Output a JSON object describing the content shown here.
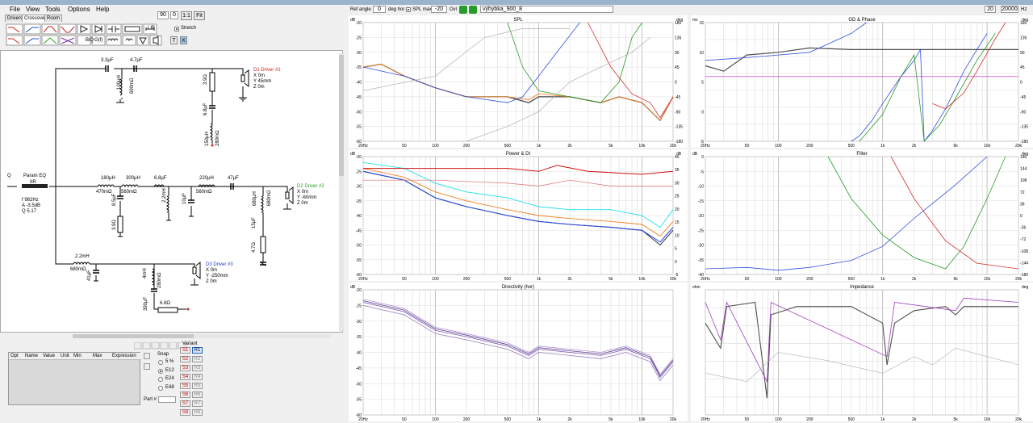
{
  "menu": [
    "File",
    "View",
    "Tools",
    "Options",
    "Help"
  ],
  "left_top": {
    "box1": "90",
    "box2": "0",
    "btn1": "1:1",
    "btn2": "Fit"
  },
  "tabs": [
    "Drivers",
    "Crossover",
    "Room"
  ],
  "toolbar": {
    "biq": "BiQ",
    "gs": "G(f)",
    "lib": "LIB",
    "t": "T",
    "x": "X",
    "stretch": "Stretch"
  },
  "schematic": {
    "param_eq": "Param EQ",
    "iir": "IIR",
    "q_label": "Q",
    "eq_f": "f  982Hz",
    "eq_a": "A  -3.5dB",
    "eq_q": "Q  5.17",
    "driver1": {
      "name": "D1 Driver #1",
      "x": "X  0m",
      "y": "Y  45mm",
      "z": "Z  0m"
    },
    "driver2": {
      "name": "D2 Driver #2",
      "x": "X  0m",
      "y": "Y  -60mm",
      "z": "Z  0m"
    },
    "driver3": {
      "name": "D3 Driver #3",
      "x": "X  0m",
      "y": "Y  -250mm",
      "z": "Z  0m"
    },
    "c1": "3.3µF",
    "c2": "4.7µF",
    "l1": "100µH",
    "r1": "690mΩ",
    "r2": "3.9Ω",
    "c3": "6.8µF",
    "l2": "150µH",
    "r3": "280mΩ",
    "l3": "180µH",
    "r4": "470mΩ",
    "l4": "300µH",
    "r5": "560mΩ",
    "c4": "6.8µF",
    "l5": "2.2mH",
    "c5": "10µF",
    "c6": "8.5µF",
    "r6": "3.9Ω",
    "l6": "220µH",
    "r7": "560mΩ",
    "c7": "47µF",
    "l7": "680µH",
    "r8": "680mΩ",
    "c8": "15µF",
    "r9": "4.7Ω",
    "l8": "2.2mH",
    "r10": "680mΩ",
    "c9": "41µF",
    "l9": "4mH",
    "r11": "280mΩ",
    "c10": "390µF",
    "r12": "6.8Ω"
  },
  "opt_table": {
    "headers": [
      "Opt",
      "Name",
      "Value",
      "Unit",
      "Min",
      "Max",
      "Expression"
    ]
  },
  "snap": {
    "label": "Snap",
    "options": [
      "5 %",
      "E12",
      "E24",
      "E48"
    ],
    "selected": 1,
    "part": "Part #"
  },
  "variant": {
    "label": "Variant",
    "items": [
      "S1",
      "R1",
      "S2",
      "R2",
      "S3",
      "R3",
      "S4",
      "R4",
      "S5",
      "R5",
      "S6",
      "R6",
      "S7",
      "R7",
      "S8",
      "R8"
    ]
  },
  "right_toolbar": {
    "ref_angle": "Ref angle",
    "ref_val": "0",
    "deg_hor": "deg hor",
    "spl_max": "SPL max",
    "spl_val": "-20",
    "ovl": "Ovl",
    "file": "výhybka_900_8",
    "r1": "20",
    "r2": "20000",
    "hz": "Hz"
  },
  "plots": {
    "spl": {
      "title": "SPL",
      "yl": "dB",
      "yr": "deg",
      "yticks": [
        "-20",
        "-25",
        "-30",
        "-35",
        "-40",
        "-45",
        "-50",
        "-55",
        "-60"
      ],
      "rticks": [
        "180",
        "135",
        "90",
        "45",
        "0",
        "-45",
        "-90",
        "-135",
        "-180"
      ]
    },
    "gd": {
      "title": "GD & Phase",
      "yl": "ms",
      "yr": "deg",
      "yticks": [
        "15",
        "10",
        "5",
        "0",
        "-5"
      ],
      "rticks": [
        "180",
        "135",
        "90",
        "45",
        "0",
        "-45",
        "-90",
        "-135",
        "-180"
      ]
    },
    "power": {
      "title": "Power & DI",
      "yl": "dB",
      "yr": "dB",
      "yticks": [
        "-20",
        "-25",
        "-30",
        "-35",
        "-40",
        "-45",
        "-50",
        "-55",
        "-60"
      ],
      "rticks": [
        "40",
        "35",
        "30",
        "25",
        "20",
        "15",
        "10",
        "5",
        "0",
        "-5"
      ]
    },
    "filter": {
      "title": "Filter",
      "yl": "dB",
      "yr": "deg",
      "yticks": [
        "0",
        "-5",
        "-10",
        "-15",
        "-20",
        "-25",
        "-30",
        "-35",
        "-40"
      ],
      "rticks": [
        "180",
        "144",
        "108",
        "72",
        "36",
        "0",
        "-36",
        "-72",
        "-108",
        "-144",
        "-180"
      ]
    },
    "dir": {
      "title": "Directivity (hor)",
      "yl": "dB",
      "yr": "",
      "yticks": [
        "-20",
        "-25",
        "-30",
        "-35",
        "-40",
        "-45",
        "-50",
        "-55",
        "-60"
      ],
      "rticks": []
    },
    "imp": {
      "title": "Impedance",
      "yl": "ohm",
      "yr": "deg",
      "yticks": [],
      "rticks": []
    },
    "xticks": [
      "20Hz",
      "50",
      "100",
      "200",
      "500",
      "1k",
      "2k",
      "5k",
      "10k",
      "20k"
    ]
  },
  "colors": {
    "accent": "#1a59c4",
    "green": "#2a9a2a",
    "red": "#d83030",
    "blue": "#3050e0",
    "orange": "#f08020",
    "cyan": "#20e0e8",
    "purple": "#a040c0"
  }
}
